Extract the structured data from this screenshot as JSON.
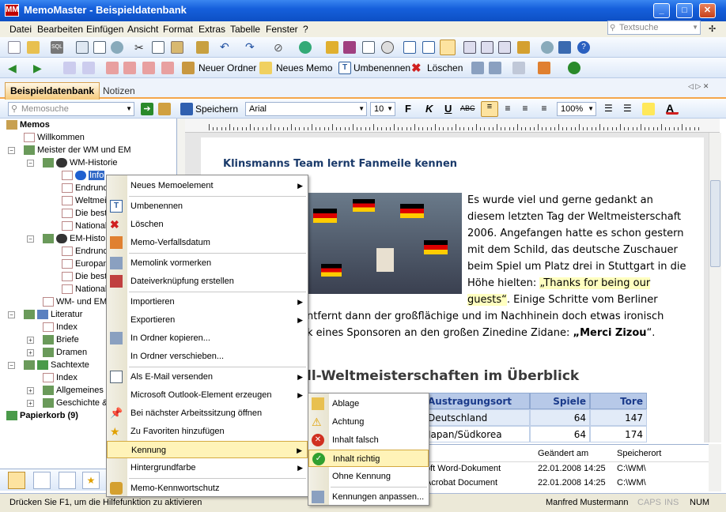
{
  "window": {
    "app_name": "MemoMaster",
    "title": "MemoMaster - Beispieldatenbank",
    "app_icon_label": "MM",
    "controls": [
      "_",
      "□",
      "✕"
    ]
  },
  "menubar": {
    "items": [
      "Datei",
      "Bearbeiten",
      "Einfügen",
      "Ansicht",
      "Format",
      "Extras",
      "Tabelle",
      "Fenster",
      "?"
    ],
    "search_placeholder": "Textsuche"
  },
  "toolbar2": {
    "new_folder": "Neuer Ordner",
    "new_memo": "Neues Memo",
    "rename": "Umbenennen",
    "delete": "Löschen"
  },
  "tabs": {
    "active": "Beispieldatenbank",
    "other": "Notizen"
  },
  "formatbar": {
    "memo_search_placeholder": "Memosuche",
    "save_label": "Speichern",
    "font": "Arial",
    "font_size": "10",
    "zoom": "100%",
    "bold": "F",
    "italic": "K",
    "underline": "U",
    "strike": "ABC"
  },
  "tree": {
    "root": "Memos",
    "items": [
      "Willkommen",
      "Meister der WM und EM",
      "WM-Historie",
      "Info",
      "Endrunde",
      "Weltmeister",
      "Die besten",
      "Nationalspieler",
      "EM-Historie",
      "Endrunde",
      "Europameister",
      "Die besten",
      "Nationalspieler",
      "WM- und EM",
      "Literatur",
      "Index",
      "Briefe",
      "Dramen",
      "Sachtexte",
      "Index",
      "Allgemeines",
      "Geschichte &"
    ],
    "trash": "Papierkorb (9)"
  },
  "document": {
    "heading1": "Klinsmanns Team lernt Fanmeile kennen",
    "para_lines": [
      "Es wurde viel und gerne gedankt an",
      "diesem letzten Tag der Weltmeisterschaft",
      "2006. Angefangen hatte es schon gestern",
      "mit dem Schild, das deutsche Zuschauer",
      "beim Spiel um Platz drei in Stuttgart in die"
    ],
    "line6_pre": "Höhe hielten: ",
    "line6_hl": "„Thanks for being our",
    "line7_hl": "guests“",
    "line7_post": ". Einige Schritte vom Berliner",
    "line8": "ntfernt dann der großflächige und im Nachhinein doch etwas ironisch",
    "line9_pre": "k eines Sponsoren an den großen Zinedine Zidane: ",
    "line9_bold": "„Merci Zizou",
    "line9_post": "“.",
    "heading2": "ll-Weltmeisterschaften im Überblick",
    "table": {
      "headers": [
        "Austragungsort",
        "Spiele",
        "Tore"
      ],
      "rows": [
        [
          "Deutschland",
          "64",
          "147"
        ],
        [
          "Japan/Südkorea",
          "64",
          "174"
        ]
      ]
    }
  },
  "filelist": {
    "headers": [
      "Geändert am",
      "Speicherort"
    ],
    "rows": [
      [
        "oft Word-Dokument",
        "22.01.2008 14:25",
        "C:\\WM\\"
      ],
      [
        "Acrobat Document",
        "22.01.2008 14:25",
        "C:\\WM\\"
      ]
    ]
  },
  "statusbar": {
    "hint": "Drücken Sie F1, um die Hilfefunktion zu aktivieren",
    "user": "Manfred Mustermann",
    "caps": "CAPS",
    "ins": "INS",
    "num": "NUM"
  },
  "context_menu": {
    "items": [
      "Neues Memoelement",
      "Umbenennen",
      "Löschen",
      "Memo-Verfallsdatum",
      "Memolink vormerken",
      "Dateiverknüpfung erstellen",
      "Importieren",
      "Exportieren",
      "In Ordner kopieren...",
      "In Ordner verschieben...",
      "Als E-Mail versenden",
      "Microsoft Outlook-Element erzeugen",
      "Bei nächster Arbeitssitzung öffnen",
      "Zu Favoriten hinzufügen",
      "Kennung",
      "Hintergrundfarbe",
      "Memo-Kennwortschutz"
    ]
  },
  "submenu": {
    "items": [
      "Ablage",
      "Achtung",
      "Inhalt falsch",
      "Inhalt richtig",
      "Ohne Kennung",
      "Kennungen anpassen..."
    ]
  }
}
